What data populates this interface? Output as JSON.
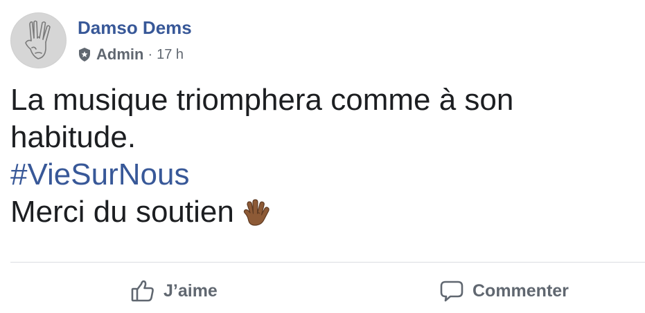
{
  "post": {
    "author": {
      "name": "Damso Dems",
      "role": "Admin",
      "role_icon": "admin-shield-icon",
      "separator": "·",
      "timestamp": "17 h",
      "avatar": "vulcan-salute-hand-avatar"
    },
    "body": {
      "line1": "La musique triomphera comme à son",
      "line2": "habitude.",
      "hashtag": "#VieSurNous",
      "line4": "Merci du soutien",
      "emoji": "vulcan-salute-emoji"
    },
    "actions": [
      {
        "label": "J’aime",
        "icon": "thumbs-up-icon"
      },
      {
        "label": "Commenter",
        "icon": "comment-bubble-icon"
      }
    ]
  },
  "colors": {
    "link": "#385898",
    "text": "#1c1e21",
    "secondary": "#606770",
    "divider": "#dadde1"
  }
}
